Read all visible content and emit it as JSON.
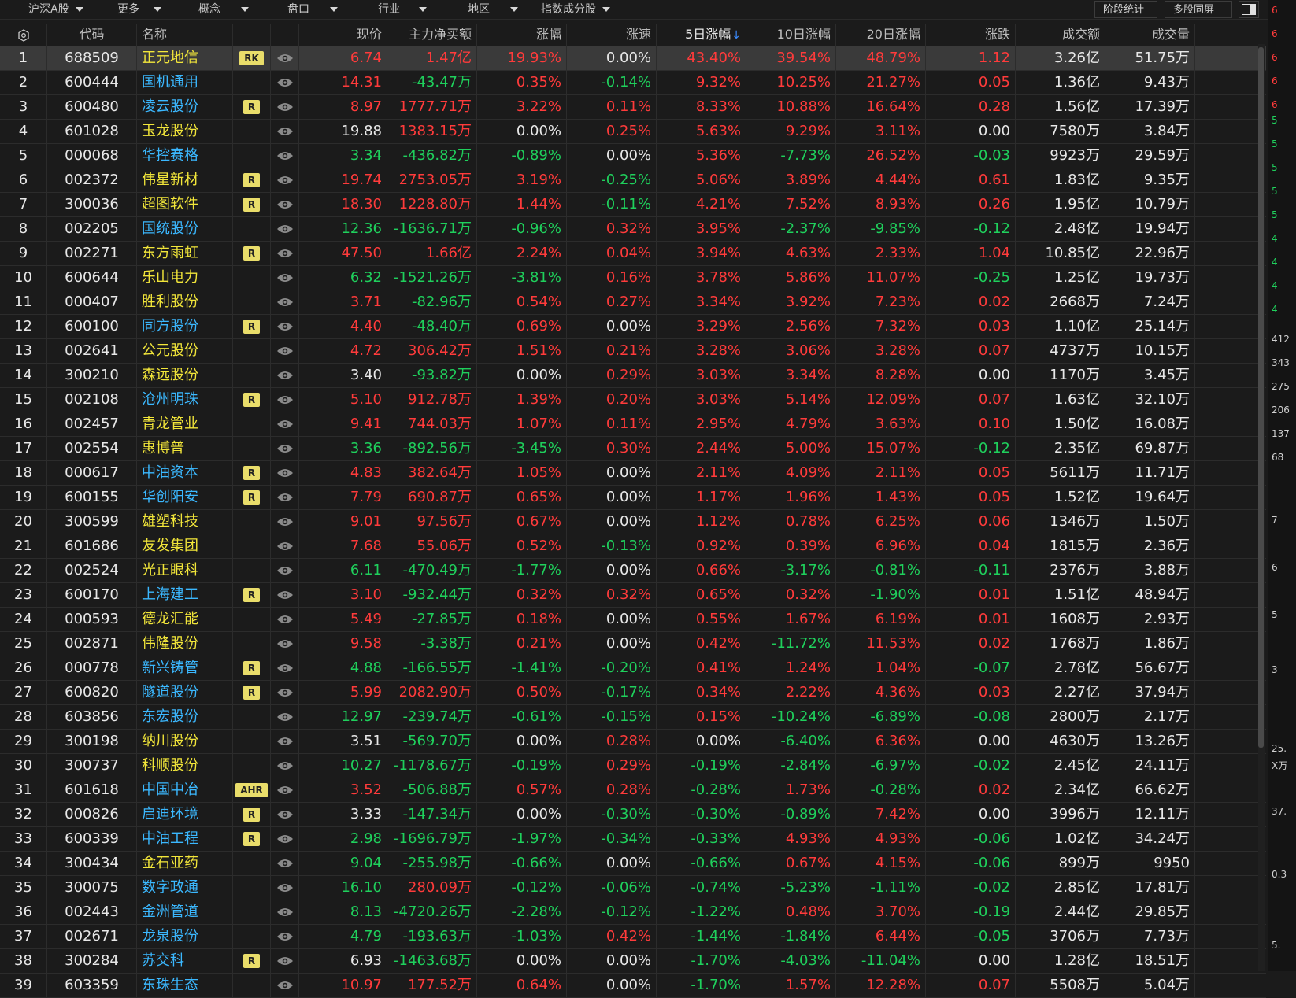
{
  "toolbar": {
    "dropdowns": [
      "沪深A股",
      "更多",
      "概念",
      "盘口",
      "行业",
      "地区",
      "指数成分股"
    ],
    "buttons": [
      "阶段统计",
      "多股同屏"
    ]
  },
  "columns": [
    "代码",
    "名称",
    "现价",
    "主力净买额",
    "涨幅",
    "涨速",
    "5日涨幅",
    "10日涨幅",
    "20日涨幅",
    "涨跌",
    "成交额",
    "成交量"
  ],
  "sort_indicator": "↓",
  "rows": [
    {
      "n": "1",
      "code": "688509",
      "name": "正元地信",
      "badge": "RK",
      "price": "6.74",
      "flow": "1.47亿",
      "chg": "19.93%",
      "speed": "0.00%",
      "d5": "43.40%",
      "d10": "39.54%",
      "d20": "48.79%",
      "diff": "1.12",
      "amount": "3.26亿",
      "vol": "51.75万"
    },
    {
      "n": "2",
      "code": "600444",
      "name": "国机通用",
      "badge": "",
      "price": "14.31",
      "flow": "-43.47万",
      "chg": "0.35%",
      "speed": "-0.14%",
      "d5": "9.32%",
      "d10": "10.25%",
      "d20": "21.27%",
      "diff": "0.05",
      "amount": "1.36亿",
      "vol": "9.43万"
    },
    {
      "n": "3",
      "code": "600480",
      "name": "凌云股份",
      "badge": "R",
      "price": "8.97",
      "flow": "1777.71万",
      "chg": "3.22%",
      "speed": "0.11%",
      "d5": "8.33%",
      "d10": "10.88%",
      "d20": "16.64%",
      "diff": "0.28",
      "amount": "1.56亿",
      "vol": "17.39万"
    },
    {
      "n": "4",
      "code": "601028",
      "name": "玉龙股份",
      "badge": "",
      "price": "19.88",
      "flow": "1383.15万",
      "chg": "0.00%",
      "speed": "0.25%",
      "d5": "5.63%",
      "d10": "9.29%",
      "d20": "3.11%",
      "diff": "0.00",
      "amount": "7580万",
      "vol": "3.84万"
    },
    {
      "n": "5",
      "code": "000068",
      "name": "华控赛格",
      "badge": "",
      "price": "3.34",
      "flow": "-436.82万",
      "chg": "-0.89%",
      "speed": "0.00%",
      "d5": "5.36%",
      "d10": "-7.73%",
      "d20": "26.52%",
      "diff": "-0.03",
      "amount": "9923万",
      "vol": "29.59万"
    },
    {
      "n": "6",
      "code": "002372",
      "name": "伟星新材",
      "badge": "R",
      "price": "19.74",
      "flow": "2753.05万",
      "chg": "3.19%",
      "speed": "-0.25%",
      "d5": "5.06%",
      "d10": "3.89%",
      "d20": "4.44%",
      "diff": "0.61",
      "amount": "1.83亿",
      "vol": "9.35万"
    },
    {
      "n": "7",
      "code": "300036",
      "name": "超图软件",
      "badge": "R",
      "price": "18.30",
      "flow": "1228.80万",
      "chg": "1.44%",
      "speed": "-0.11%",
      "d5": "4.21%",
      "d10": "7.52%",
      "d20": "8.93%",
      "diff": "0.26",
      "amount": "1.95亿",
      "vol": "10.79万"
    },
    {
      "n": "8",
      "code": "002205",
      "name": "国统股份",
      "badge": "",
      "price": "12.36",
      "flow": "-1636.71万",
      "chg": "-0.96%",
      "speed": "0.32%",
      "d5": "3.95%",
      "d10": "-2.37%",
      "d20": "-9.85%",
      "diff": "-0.12",
      "amount": "2.48亿",
      "vol": "19.94万"
    },
    {
      "n": "9",
      "code": "002271",
      "name": "东方雨虹",
      "badge": "R",
      "price": "47.50",
      "flow": "1.66亿",
      "chg": "2.24%",
      "speed": "0.04%",
      "d5": "3.94%",
      "d10": "4.63%",
      "d20": "2.33%",
      "diff": "1.04",
      "amount": "10.85亿",
      "vol": "22.96万"
    },
    {
      "n": "10",
      "code": "600644",
      "name": "乐山电力",
      "badge": "",
      "price": "6.32",
      "flow": "-1521.26万",
      "chg": "-3.81%",
      "speed": "0.16%",
      "d5": "3.78%",
      "d10": "5.86%",
      "d20": "11.07%",
      "diff": "-0.25",
      "amount": "1.25亿",
      "vol": "19.73万"
    },
    {
      "n": "11",
      "code": "000407",
      "name": "胜利股份",
      "badge": "",
      "price": "3.71",
      "flow": "-82.96万",
      "chg": "0.54%",
      "speed": "0.27%",
      "d5": "3.34%",
      "d10": "3.92%",
      "d20": "7.23%",
      "diff": "0.02",
      "amount": "2668万",
      "vol": "7.24万"
    },
    {
      "n": "12",
      "code": "600100",
      "name": "同方股份",
      "badge": "R",
      "price": "4.40",
      "flow": "-48.40万",
      "chg": "0.69%",
      "speed": "0.00%",
      "d5": "3.29%",
      "d10": "2.56%",
      "d20": "7.32%",
      "diff": "0.03",
      "amount": "1.10亿",
      "vol": "25.14万"
    },
    {
      "n": "13",
      "code": "002641",
      "name": "公元股份",
      "badge": "",
      "price": "4.72",
      "flow": "306.42万",
      "chg": "1.51%",
      "speed": "0.21%",
      "d5": "3.28%",
      "d10": "3.06%",
      "d20": "3.28%",
      "diff": "0.07",
      "amount": "4737万",
      "vol": "10.15万"
    },
    {
      "n": "14",
      "code": "300210",
      "name": "森远股份",
      "badge": "",
      "price": "3.40",
      "flow": "-93.82万",
      "chg": "0.00%",
      "speed": "0.29%",
      "d5": "3.03%",
      "d10": "3.34%",
      "d20": "8.28%",
      "diff": "0.00",
      "amount": "1170万",
      "vol": "3.45万"
    },
    {
      "n": "15",
      "code": "002108",
      "name": "沧州明珠",
      "badge": "R",
      "price": "5.10",
      "flow": "912.78万",
      "chg": "1.39%",
      "speed": "0.20%",
      "d5": "3.03%",
      "d10": "5.14%",
      "d20": "12.09%",
      "diff": "0.07",
      "amount": "1.63亿",
      "vol": "32.10万"
    },
    {
      "n": "16",
      "code": "002457",
      "name": "青龙管业",
      "badge": "",
      "price": "9.41",
      "flow": "744.03万",
      "chg": "1.07%",
      "speed": "0.11%",
      "d5": "2.95%",
      "d10": "4.79%",
      "d20": "3.63%",
      "diff": "0.10",
      "amount": "1.50亿",
      "vol": "16.08万"
    },
    {
      "n": "17",
      "code": "002554",
      "name": "惠博普",
      "badge": "",
      "price": "3.36",
      "flow": "-892.56万",
      "chg": "-3.45%",
      "speed": "0.30%",
      "d5": "2.44%",
      "d10": "5.00%",
      "d20": "15.07%",
      "diff": "-0.12",
      "amount": "2.35亿",
      "vol": "69.87万"
    },
    {
      "n": "18",
      "code": "000617",
      "name": "中油资本",
      "badge": "R",
      "price": "4.83",
      "flow": "382.64万",
      "chg": "1.05%",
      "speed": "0.00%",
      "d5": "2.11%",
      "d10": "4.09%",
      "d20": "2.11%",
      "diff": "0.05",
      "amount": "5611万",
      "vol": "11.71万"
    },
    {
      "n": "19",
      "code": "600155",
      "name": "华创阳安",
      "badge": "R",
      "price": "7.79",
      "flow": "690.87万",
      "chg": "0.65%",
      "speed": "0.00%",
      "d5": "1.17%",
      "d10": "1.96%",
      "d20": "1.43%",
      "diff": "0.05",
      "amount": "1.52亿",
      "vol": "19.64万"
    },
    {
      "n": "20",
      "code": "300599",
      "name": "雄塑科技",
      "badge": "",
      "price": "9.01",
      "flow": "97.56万",
      "chg": "0.67%",
      "speed": "0.00%",
      "d5": "1.12%",
      "d10": "0.78%",
      "d20": "6.25%",
      "diff": "0.06",
      "amount": "1346万",
      "vol": "1.50万"
    },
    {
      "n": "21",
      "code": "601686",
      "name": "友发集团",
      "badge": "",
      "price": "7.68",
      "flow": "55.06万",
      "chg": "0.52%",
      "speed": "-0.13%",
      "d5": "0.92%",
      "d10": "0.39%",
      "d20": "6.96%",
      "diff": "0.04",
      "amount": "1815万",
      "vol": "2.36万"
    },
    {
      "n": "22",
      "code": "002524",
      "name": "光正眼科",
      "badge": "",
      "price": "6.11",
      "flow": "-470.49万",
      "chg": "-1.77%",
      "speed": "0.00%",
      "d5": "0.66%",
      "d10": "-3.17%",
      "d20": "-0.81%",
      "diff": "-0.11",
      "amount": "2376万",
      "vol": "3.88万"
    },
    {
      "n": "23",
      "code": "600170",
      "name": "上海建工",
      "badge": "R",
      "price": "3.10",
      "flow": "-932.44万",
      "chg": "0.32%",
      "speed": "0.32%",
      "d5": "0.65%",
      "d10": "0.32%",
      "d20": "-1.90%",
      "diff": "0.01",
      "amount": "1.51亿",
      "vol": "48.94万"
    },
    {
      "n": "24",
      "code": "000593",
      "name": "德龙汇能",
      "badge": "",
      "price": "5.49",
      "flow": "-27.85万",
      "chg": "0.18%",
      "speed": "0.00%",
      "d5": "0.55%",
      "d10": "1.67%",
      "d20": "6.19%",
      "diff": "0.01",
      "amount": "1608万",
      "vol": "2.93万"
    },
    {
      "n": "25",
      "code": "002871",
      "name": "伟隆股份",
      "badge": "",
      "price": "9.58",
      "flow": "-3.38万",
      "chg": "0.21%",
      "speed": "0.00%",
      "d5": "0.42%",
      "d10": "-11.72%",
      "d20": "11.53%",
      "diff": "0.02",
      "amount": "1768万",
      "vol": "1.86万"
    },
    {
      "n": "26",
      "code": "000778",
      "name": "新兴铸管",
      "badge": "R",
      "price": "4.88",
      "flow": "-166.55万",
      "chg": "-1.41%",
      "speed": "-0.20%",
      "d5": "0.41%",
      "d10": "1.24%",
      "d20": "1.04%",
      "diff": "-0.07",
      "amount": "2.78亿",
      "vol": "56.67万"
    },
    {
      "n": "27",
      "code": "600820",
      "name": "隧道股份",
      "badge": "R",
      "price": "5.99",
      "flow": "2082.90万",
      "chg": "0.50%",
      "speed": "-0.17%",
      "d5": "0.34%",
      "d10": "2.22%",
      "d20": "4.36%",
      "diff": "0.03",
      "amount": "2.27亿",
      "vol": "37.94万"
    },
    {
      "n": "28",
      "code": "603856",
      "name": "东宏股份",
      "badge": "",
      "price": "12.97",
      "flow": "-239.74万",
      "chg": "-0.61%",
      "speed": "-0.15%",
      "d5": "0.15%",
      "d10": "-10.24%",
      "d20": "-6.89%",
      "diff": "-0.08",
      "amount": "2800万",
      "vol": "2.17万"
    },
    {
      "n": "29",
      "code": "300198",
      "name": "纳川股份",
      "badge": "",
      "price": "3.51",
      "flow": "-569.70万",
      "chg": "0.00%",
      "speed": "0.28%",
      "d5": "0.00%",
      "d10": "-6.40%",
      "d20": "6.36%",
      "diff": "0.00",
      "amount": "4630万",
      "vol": "13.26万"
    },
    {
      "n": "30",
      "code": "300737",
      "name": "科顺股份",
      "badge": "",
      "price": "10.27",
      "flow": "-1178.67万",
      "chg": "-0.19%",
      "speed": "0.29%",
      "d5": "-0.19%",
      "d10": "-2.84%",
      "d20": "-6.97%",
      "diff": "-0.02",
      "amount": "2.45亿",
      "vol": "24.11万"
    },
    {
      "n": "31",
      "code": "601618",
      "name": "中国中冶",
      "badge": "AHR",
      "price": "3.52",
      "flow": "-506.88万",
      "chg": "0.57%",
      "speed": "0.28%",
      "d5": "-0.28%",
      "d10": "1.73%",
      "d20": "-0.28%",
      "diff": "0.02",
      "amount": "2.34亿",
      "vol": "66.62万"
    },
    {
      "n": "32",
      "code": "000826",
      "name": "启迪环境",
      "badge": "R",
      "price": "3.33",
      "flow": "-147.34万",
      "chg": "0.00%",
      "speed": "-0.30%",
      "d5": "-0.30%",
      "d10": "-0.89%",
      "d20": "7.42%",
      "diff": "0.00",
      "amount": "3996万",
      "vol": "12.11万"
    },
    {
      "n": "33",
      "code": "600339",
      "name": "中油工程",
      "badge": "R",
      "price": "2.98",
      "flow": "-1696.79万",
      "chg": "-1.97%",
      "speed": "-0.34%",
      "d5": "-0.33%",
      "d10": "4.93%",
      "d20": "4.93%",
      "diff": "-0.06",
      "amount": "1.02亿",
      "vol": "34.24万"
    },
    {
      "n": "34",
      "code": "300434",
      "name": "金石亚药",
      "badge": "",
      "price": "9.04",
      "flow": "-255.98万",
      "chg": "-0.66%",
      "speed": "0.00%",
      "d5": "-0.66%",
      "d10": "0.67%",
      "d20": "4.15%",
      "diff": "-0.06",
      "amount": "899万",
      "vol": "9950"
    },
    {
      "n": "35",
      "code": "300075",
      "name": "数字政通",
      "badge": "",
      "price": "16.10",
      "flow": "280.09万",
      "chg": "-0.12%",
      "speed": "-0.06%",
      "d5": "-0.74%",
      "d10": "-5.23%",
      "d20": "-1.11%",
      "diff": "-0.02",
      "amount": "2.85亿",
      "vol": "17.81万"
    },
    {
      "n": "36",
      "code": "002443",
      "name": "金洲管道",
      "badge": "",
      "price": "8.13",
      "flow": "-4720.26万",
      "chg": "-2.28%",
      "speed": "-0.12%",
      "d5": "-1.22%",
      "d10": "0.48%",
      "d20": "3.70%",
      "diff": "-0.19",
      "amount": "2.44亿",
      "vol": "29.85万"
    },
    {
      "n": "37",
      "code": "002671",
      "name": "龙泉股份",
      "badge": "",
      "price": "4.79",
      "flow": "-193.63万",
      "chg": "-1.03%",
      "speed": "0.42%",
      "d5": "-1.44%",
      "d10": "-1.84%",
      "d20": "6.44%",
      "diff": "-0.05",
      "amount": "3706万",
      "vol": "7.73万"
    },
    {
      "n": "38",
      "code": "300284",
      "name": "苏交科",
      "badge": "R",
      "price": "6.93",
      "flow": "-1463.68万",
      "chg": "0.00%",
      "speed": "0.00%",
      "d5": "-1.70%",
      "d10": "-4.03%",
      "d20": "-11.04%",
      "diff": "0.00",
      "amount": "1.28亿",
      "vol": "18.51万"
    },
    {
      "n": "39",
      "code": "603359",
      "name": "东珠生态",
      "badge": "",
      "price": "10.97",
      "flow": "177.52万",
      "chg": "0.64%",
      "speed": "0.00%",
      "d5": "-1.70%",
      "d10": "1.57%",
      "d20": "12.28%",
      "diff": "0.07",
      "amount": "5508万",
      "vol": "5.04万"
    }
  ],
  "right_strip_labels": [
    "6",
    "6",
    "6",
    "6",
    "6",
    "5",
    "5",
    "5",
    "5",
    "5",
    "4",
    "4",
    "4",
    "4",
    "412",
    "343",
    "275",
    "206",
    "137",
    "68",
    "7",
    "6",
    "5",
    "3",
    "25.",
    "X万",
    "37.",
    "0.3",
    "5."
  ],
  "colors": {
    "up": "#ff3b3b",
    "down": "#1fd05c",
    "flat": "#e8e8e8",
    "badge": "#e9dd6a",
    "name_default": "#f2e63a",
    "name_margin": "#3bb8ff"
  }
}
